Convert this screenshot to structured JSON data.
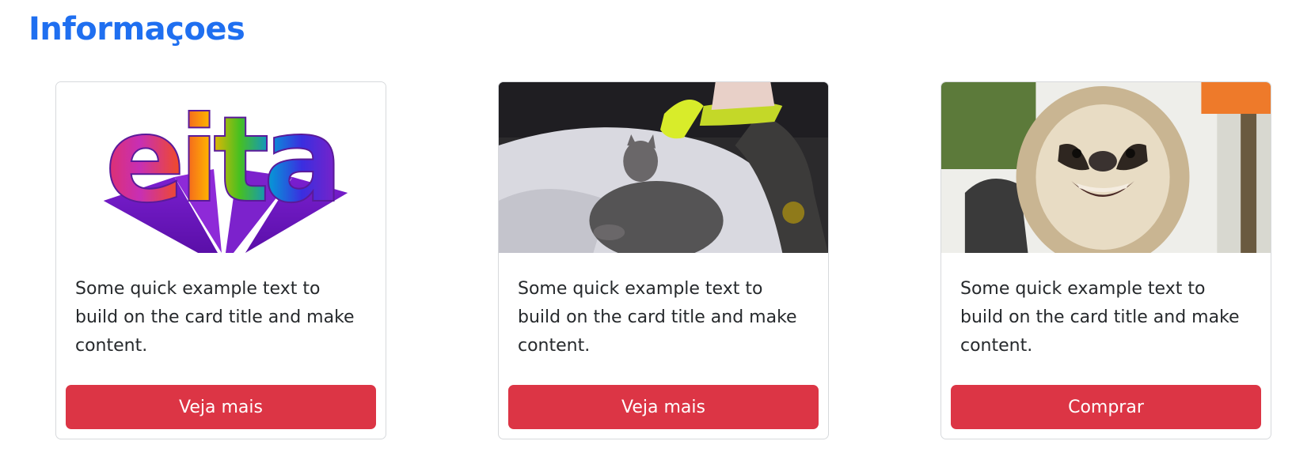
{
  "page": {
    "title": "Informaçoes"
  },
  "cards": [
    {
      "image_label": "eita",
      "text": "Some quick example text to build on the card title and make content.",
      "button_label": "Veja mais"
    },
    {
      "text": "Some quick example text to build on the card title and make content.",
      "button_label": "Veja mais"
    },
    {
      "text": "Some quick example text to build on the card title and make content.",
      "button_label": "Comprar"
    }
  ],
  "colors": {
    "title": "#1f6ff0",
    "button": "#dc3545",
    "button_text": "#ffffff",
    "card_border": "#d7d9dc"
  }
}
